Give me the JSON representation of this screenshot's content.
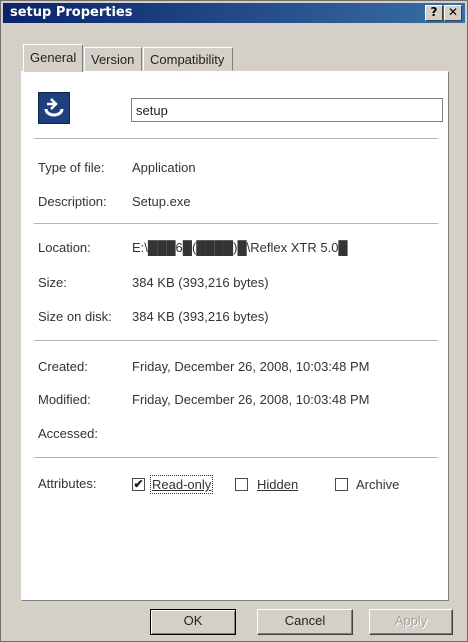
{
  "window": {
    "title": "setup Properties",
    "help_label": "?",
    "close_label": "✕"
  },
  "tabs": [
    {
      "label": "General",
      "active": true
    },
    {
      "label": "Version",
      "active": false
    },
    {
      "label": "Compatibility",
      "active": false
    }
  ],
  "file": {
    "name": "setup",
    "icon": "setup-program-icon",
    "icon_color": "#1f3f7f"
  },
  "info": {
    "type_label": "Type of file:",
    "type_value": "Application",
    "description_label": "Description:",
    "description_value": "Setup.exe",
    "location_label": "Location:",
    "location_value": "E:\\███6█(████)█\\Reflex XTR 5.0█",
    "size_label": "Size:",
    "size_value": "384 KB (393,216 bytes)",
    "size_on_disk_label": "Size on disk:",
    "size_on_disk_value": "384 KB (393,216 bytes)",
    "created_label": "Created:",
    "created_value": "Friday, December 26, 2008, 10:03:48 PM",
    "modified_label": "Modified:",
    "modified_value": "Friday, December 26, 2008, 10:03:48 PM",
    "accessed_label": "Accessed:",
    "accessed_value": ""
  },
  "attributes": {
    "label": "Attributes:",
    "read_only": {
      "label": "Read-only",
      "checked": true,
      "mark": "✔"
    },
    "hidden": {
      "label": "Hidden",
      "checked": false,
      "mark": ""
    },
    "archive": {
      "label": "Archive",
      "checked": false,
      "mark": ""
    }
  },
  "buttons": {
    "ok": "OK",
    "cancel": "Cancel",
    "apply": "Apply"
  }
}
